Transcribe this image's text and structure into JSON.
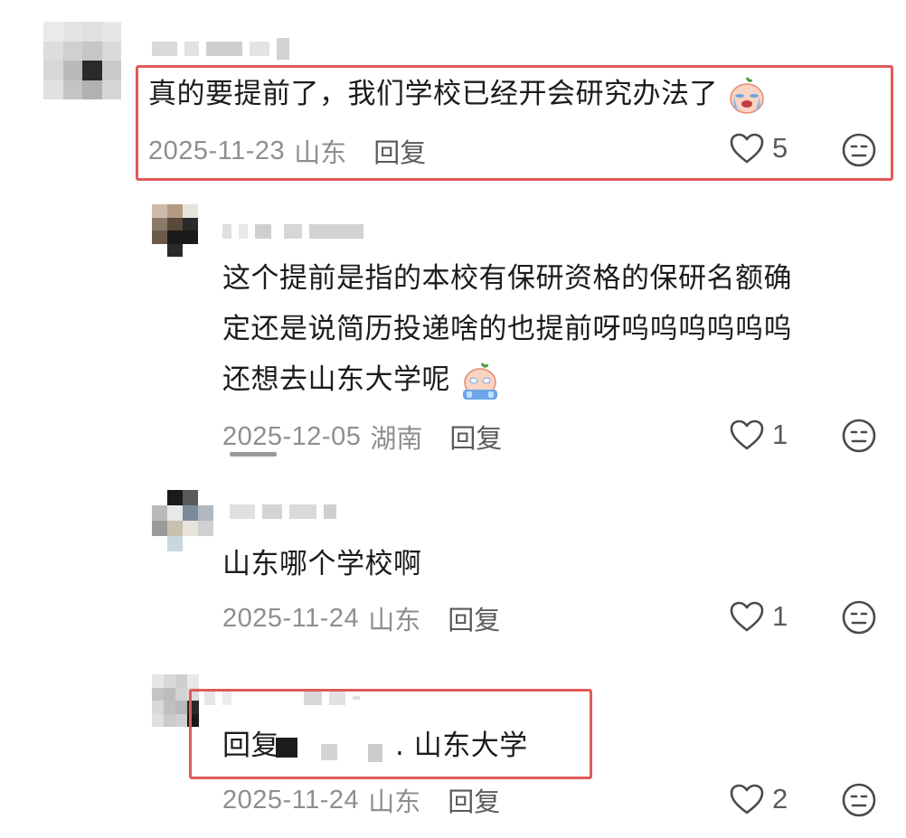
{
  "comments": [
    {
      "text": "真的要提前了，我们学校已经开会研究办法了",
      "date": "2025-11-23",
      "location": "山东",
      "reply_label": "回复",
      "likes": "5"
    },
    {
      "text_lines": [
        "这个提前是指的本校有保研资格的保研名额确",
        "定还是说简历投递啥的也提前呀呜呜呜呜呜呜",
        "还想去山东大学呢"
      ],
      "date": "2025-12-05",
      "location": "湖南",
      "reply_label": "回复",
      "likes": "1"
    },
    {
      "text": "山东哪个学校啊",
      "date": "2025-11-24",
      "location": "山东",
      "reply_label": "回复",
      "likes": "1"
    },
    {
      "text_prefix": "回复",
      "text_suffix": ". 山东大学",
      "date": "2025-11-24",
      "location": "山东",
      "reply_label": "回复",
      "likes": "2"
    }
  ],
  "icons": {
    "like": "heart-outline-icon",
    "dislike": "neutral-face-icon",
    "emoji_cry": "crying-emoji-icon",
    "emoji_sob": "sobbing-emoji-icon"
  },
  "colors": {
    "highlight_border": "#e05a5a",
    "meta_text": "#8e8e8e"
  }
}
